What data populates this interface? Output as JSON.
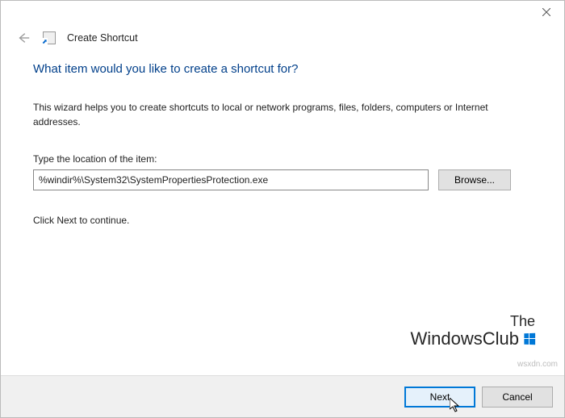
{
  "header": {
    "title": "Create Shortcut"
  },
  "page": {
    "title": "What item would you like to create a shortcut for?",
    "description": "This wizard helps you to create shortcuts to local or network programs, files, folders, computers or Internet addresses.",
    "location_label": "Type the location of the item:",
    "location_value": "%windir%\\System32\\SystemPropertiesProtection.exe",
    "browse_label": "Browse...",
    "continue_text": "Click Next to continue."
  },
  "footer": {
    "next_label": "Next",
    "cancel_label": "Cancel"
  },
  "watermark": {
    "line1": "The",
    "line2": "WindowsClub",
    "url": "wsxdn.com"
  }
}
